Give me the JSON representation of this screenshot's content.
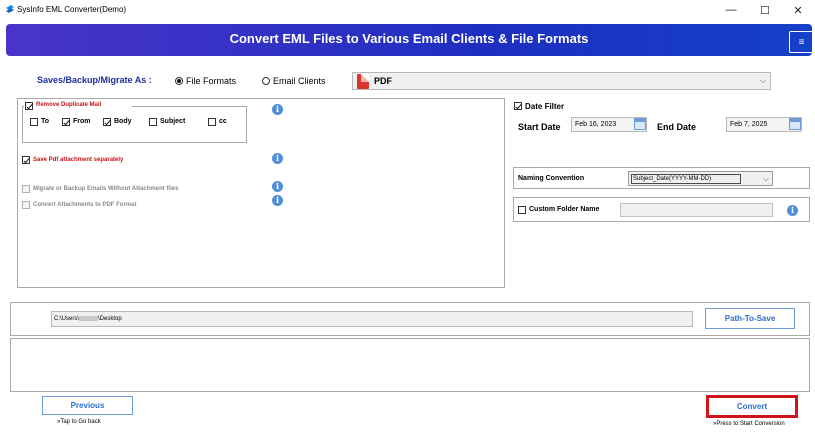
{
  "window": {
    "title": "SysInfo EML Converter(Demo)",
    "minimize": "—",
    "maximize": "☐",
    "close": "✕"
  },
  "banner": {
    "headline": "Convert EML Files to Various Email Clients & File Formats",
    "menu_icon": "≡"
  },
  "save_as": {
    "label": "Saves/Backup/Migrate As :",
    "options": [
      {
        "label": "File Formats",
        "selected": true
      },
      {
        "label": "Email Clients",
        "selected": false
      }
    ],
    "format_value": "PDF"
  },
  "options_panel": {
    "remove_duplicate": {
      "label": "Remove Duplicate Mail",
      "checked": true
    },
    "fields": [
      {
        "label": "To",
        "checked": false
      },
      {
        "label": "From",
        "checked": true
      },
      {
        "label": "Body",
        "checked": true
      },
      {
        "label": "Subject",
        "checked": false
      },
      {
        "label": "cc",
        "checked": false
      }
    ],
    "save_pdf_attachment": {
      "label": "Save Pdf attachment separately",
      "checked": true
    },
    "migrate_without_attachment": {
      "label": "Migrate or Backup Emails Without Attachment files",
      "checked": false
    },
    "convert_attachments_pdf": {
      "label": "Convert Attachments to PDF Format",
      "checked": false
    }
  },
  "date_filter": {
    "label": "Date Filter",
    "checked": true,
    "start_label": "Start Date",
    "start_value": "Feb 16, 2023",
    "end_label": "End Date",
    "end_value": "Feb 7, 2025"
  },
  "naming": {
    "label": "Naming Convention",
    "value": "Subject_Date(YYYY-MM-DD)"
  },
  "custom_folder": {
    "label": "Custom Folder Name",
    "checked": false,
    "value": ""
  },
  "path": {
    "value_prefix": "C:\\Users\\",
    "value_suffix": "\\Desktop",
    "button": "Path-To-Save"
  },
  "footer": {
    "previous": "Previous",
    "previous_hint": "»Tap to Go back",
    "convert": "Convert",
    "convert_hint": "»Press to Start Conversion"
  },
  "colors": {
    "banner_start": "#4a34c9",
    "banner_end": "#1540c8",
    "accent_blue": "#2c6dd0",
    "label_red": "#c8141a",
    "highlight_red": "#d0141a"
  }
}
